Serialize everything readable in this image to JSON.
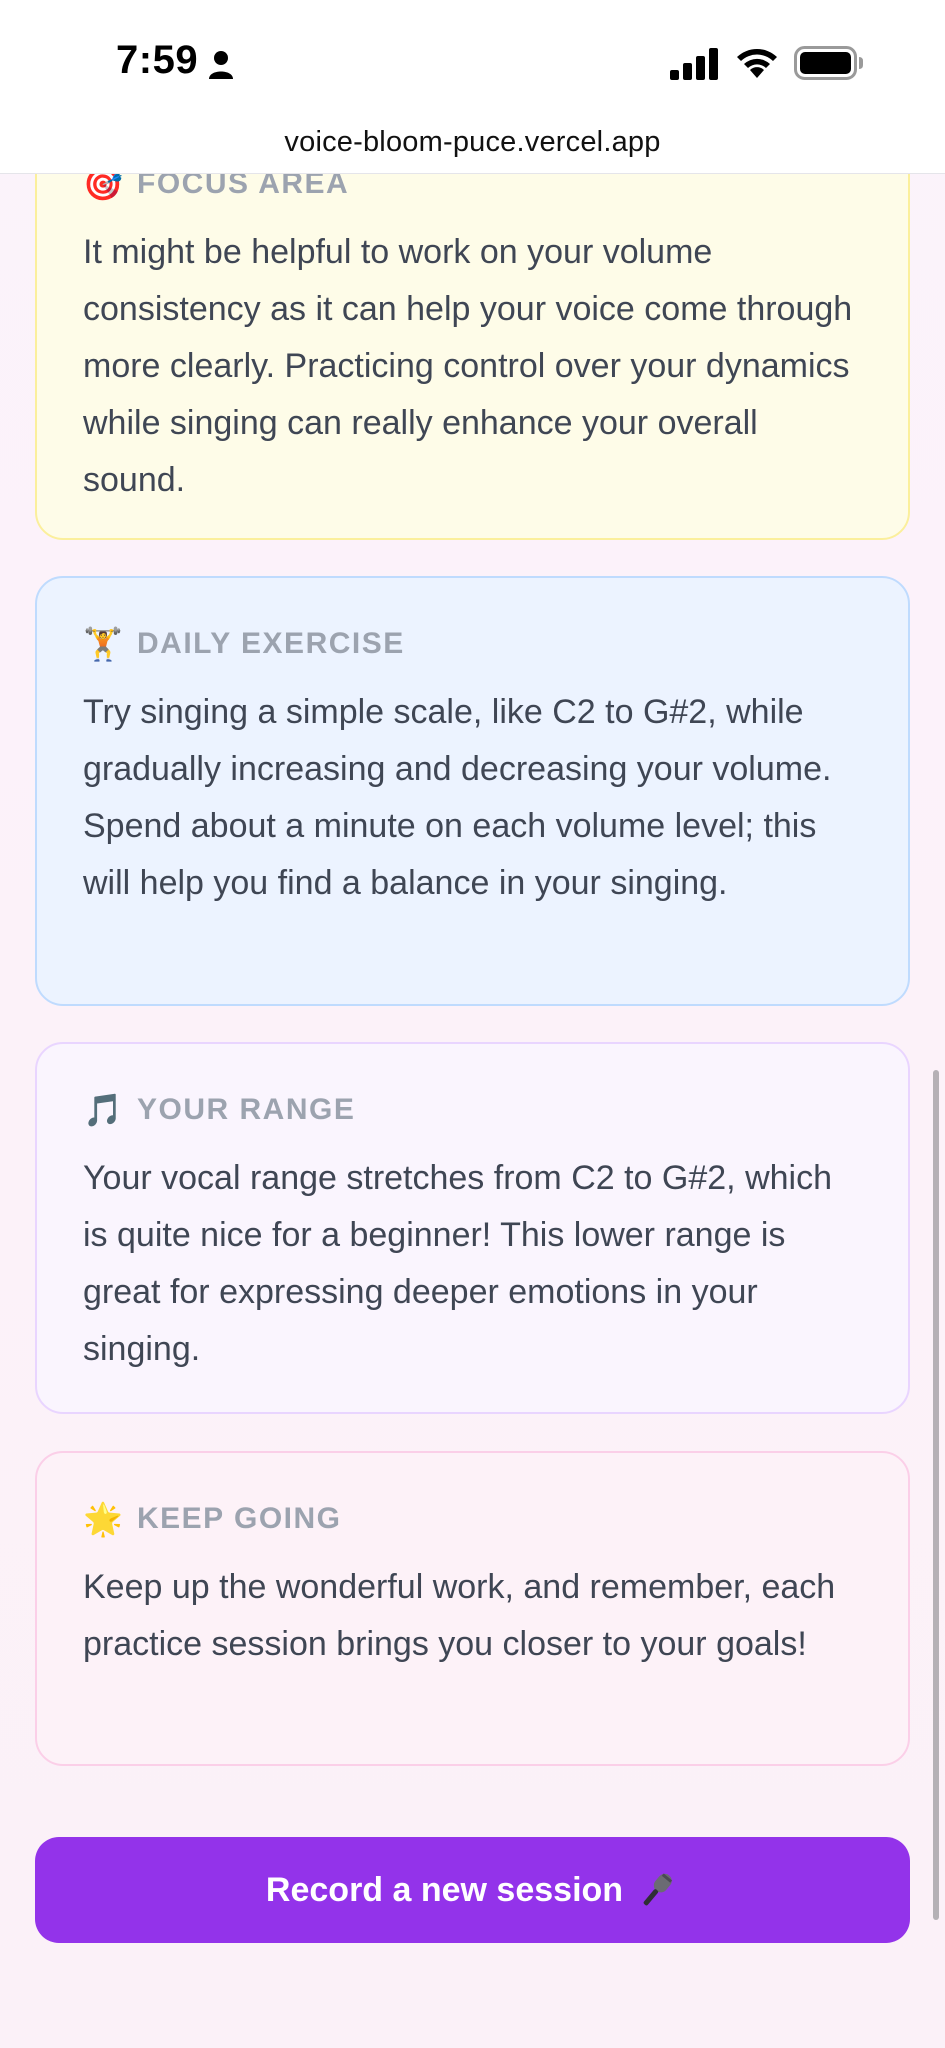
{
  "status_bar": {
    "time": "7:59",
    "icons": [
      "person-icon",
      "signal-icon",
      "wifi-icon",
      "battery-icon"
    ]
  },
  "browser": {
    "url": "voice-bloom-puce.vercel.app"
  },
  "cards": {
    "focus": {
      "icon": "target-icon",
      "emoji": "🎯",
      "title": "FOCUS AREA",
      "body": "It might be helpful to work on your volume consistency as it can help your voice come through more clearly. Practicing control over your dynamics while singing can really enhance your overall sound."
    },
    "daily": {
      "icon": "weightlifter-icon",
      "emoji": "🏋️",
      "title": "DAILY EXERCISE",
      "body": "Try singing a simple scale, like C2 to G#2, while gradually increasing and decreasing your volume. Spend about a minute on each volume level; this will help you find a balance in your singing."
    },
    "range": {
      "icon": "music-note-icon",
      "emoji": "🎵",
      "title": "YOUR RANGE",
      "body": "Your vocal range stretches from C2 to G#2, which is quite nice for a beginner! This lower range is great for expressing deeper emotions in your singing."
    },
    "keep": {
      "icon": "star-icon",
      "emoji": "🌟",
      "title": "KEEP GOING",
      "body": "Keep up the wonderful work, and remember, each practice session brings you closer to your goals!"
    }
  },
  "record_button": {
    "label": "Record a new session",
    "icon": "microphone-icon"
  },
  "colors": {
    "accent": "#9333ea",
    "focus_bg": "#fefce8",
    "daily_bg": "#ecf3ff",
    "range_bg": "#faf5fe",
    "keep_bg": "#fdf2f8"
  }
}
